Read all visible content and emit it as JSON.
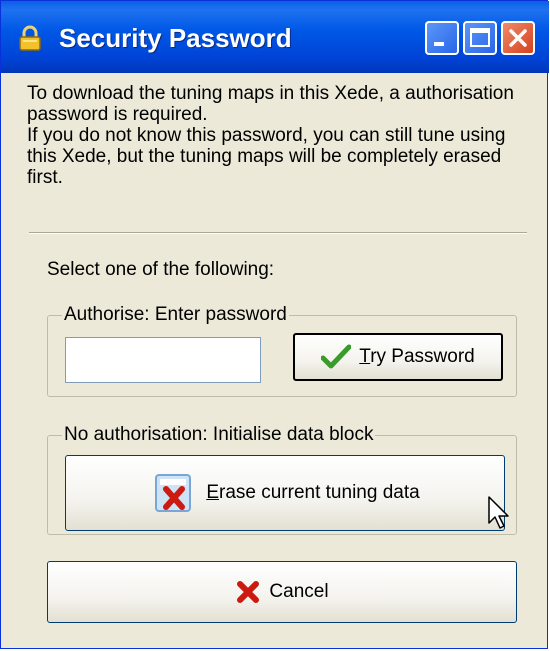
{
  "window": {
    "title": "Security Password"
  },
  "intro": {
    "line1": "To download the tuning maps in this Xede, a authorisation password is required.",
    "line2": "If you do not know this password, you can still tune using this Xede, but the tuning maps will be completely erased first."
  },
  "select_label": "Select one of the following:",
  "auth_group": {
    "legend": "Authorise: Enter password",
    "password_value": "",
    "try_button": {
      "accel": "T",
      "rest": "ry Password"
    }
  },
  "noauth_group": {
    "legend": "No authorisation: Initialise data block",
    "erase_button": {
      "accel": "E",
      "rest": "rase current tuning data"
    }
  },
  "cancel_button": {
    "label": "Cancel"
  },
  "colors": {
    "titlebar": "#0058e6",
    "dialog_bg": "#ece9d8",
    "check_green": "#3a9a2a",
    "cross_red": "#cc1a10"
  },
  "icons": {
    "title": "padlock-icon",
    "try": "checkmark-icon",
    "erase": "erase-data-icon",
    "cancel": "red-x-icon"
  }
}
